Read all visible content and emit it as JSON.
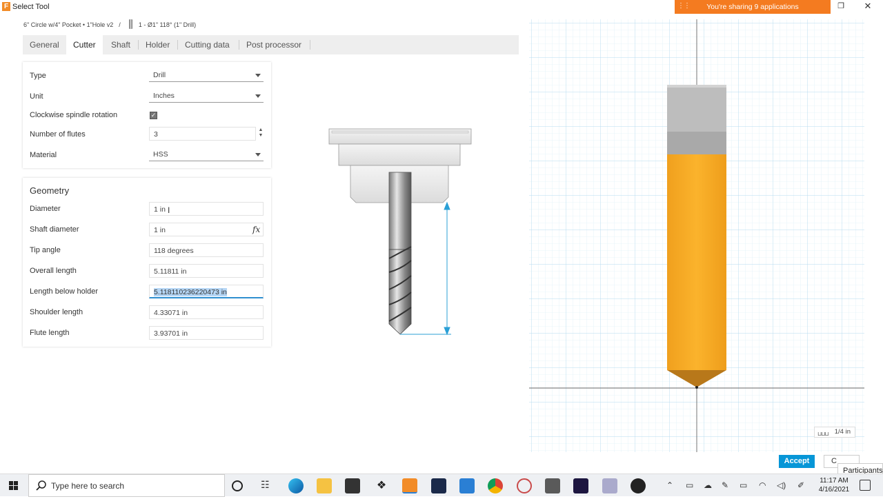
{
  "window": {
    "app_icon": "F",
    "title": "Select Tool",
    "share_banner": "You're sharing 9 applications"
  },
  "breadcrumb": {
    "library": "6\" Circle w/4\" Pocket • 1\"Hole v2",
    "separator": "/",
    "tool": "1 - Ø1\" 118° (1\" Drill)"
  },
  "tabs": [
    {
      "label": "General"
    },
    {
      "label": "Cutter"
    },
    {
      "label": "Shaft"
    },
    {
      "label": "Holder"
    },
    {
      "label": "Cutting data"
    },
    {
      "label": "Post processor"
    }
  ],
  "active_tab": "Cutter",
  "cutter": {
    "type_label": "Type",
    "type_value": "Drill",
    "unit_label": "Unit",
    "unit_value": "Inches",
    "cw_label": "Clockwise spindle rotation",
    "cw_checked": "✓",
    "flutes_label": "Number of flutes",
    "flutes_value": "3",
    "material_label": "Material",
    "material_value": "HSS"
  },
  "geometry": {
    "title": "Geometry",
    "diameter_label": "Diameter",
    "diameter_value": "1 in",
    "shaft_diameter_label": "Shaft diameter",
    "shaft_diameter_value": "1 in",
    "fx": "fx",
    "tip_angle_label": "Tip angle",
    "tip_angle_value": "118 degrees",
    "overall_length_label": "Overall length",
    "overall_length_value": "5.11811 in",
    "length_below_holder_label": "Length below holder",
    "length_below_holder_value": "5.118110236220473 in",
    "shoulder_length_label": "Shoulder length",
    "shoulder_length_value": "4.33071 in",
    "flute_length_label": "Flute length",
    "flute_length_value": "3.93701 in"
  },
  "viewport": {
    "scale_label": "1/4 in",
    "tool_color": "#f7a823",
    "grid_color": "#cde6f3"
  },
  "buttons": {
    "accept": "Accept",
    "cancel": "C",
    "participants": "Participants"
  },
  "taskbar": {
    "search_placeholder": "Type here to search",
    "time": "11:17 AM",
    "date": "4/16/2021"
  },
  "colors": {
    "accent": "#0696d7",
    "share_banner": "#f47b20"
  }
}
